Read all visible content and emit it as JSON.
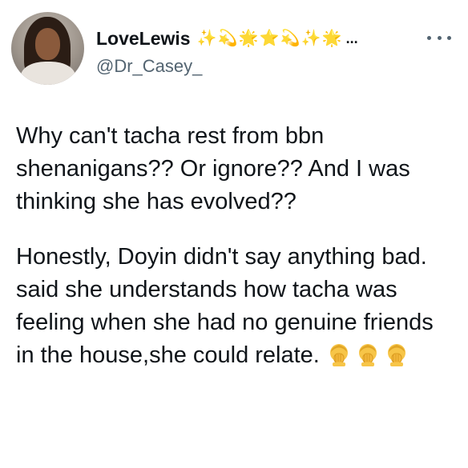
{
  "author": {
    "display_name": "LoveLewis",
    "handle": "@Dr_Casey_",
    "avatar_icon": "profile-photo",
    "name_emojis": [
      "sparkles",
      "dizzy",
      "glowing-star",
      "star",
      "dizzy",
      "sparkles",
      "glowing-star"
    ],
    "truncated_mark": "..."
  },
  "more_menu_icon": "more-horizontal-icon",
  "tweet": {
    "paragraphs": [
      "Why can't tacha rest from bbn shenanigans?? Or ignore?? And I was thinking she has evolved??",
      "Honestly, Doyin didn't say anything bad. said she understands how tacha was feeling when she had no genuine friends in the house,she  could relate."
    ],
    "trailing_emojis": [
      "person-facepalming",
      "person-facepalming",
      "person-facepalming"
    ]
  },
  "colors": {
    "text": "#0f1419",
    "secondary": "#536471",
    "emoji_yellow": "#f5b400"
  }
}
